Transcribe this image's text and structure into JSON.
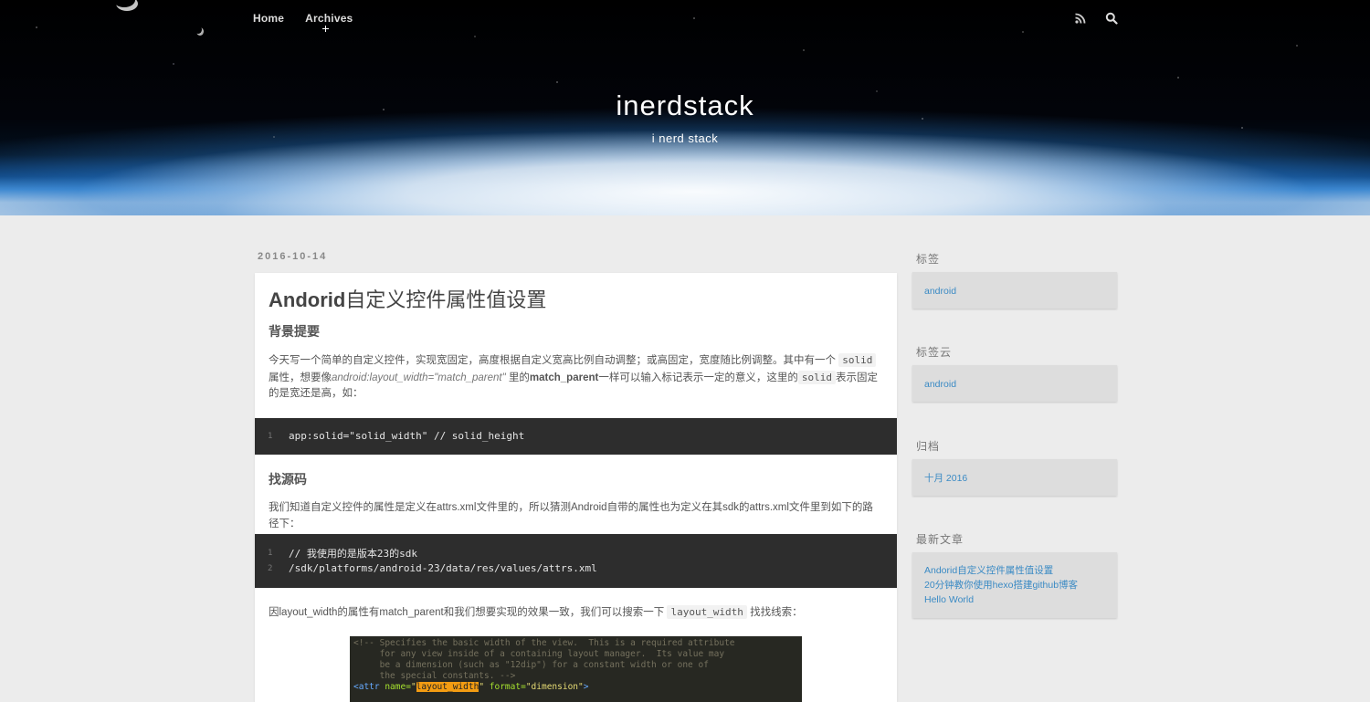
{
  "nav": {
    "items": [
      "Home",
      "Archives"
    ],
    "rss_icon": "rss-icon",
    "search_icon": "search-icon"
  },
  "site": {
    "title": "inerdstack",
    "subtitle": "i nerd stack"
  },
  "post": {
    "date": "2016-10-14",
    "title_prefix": "Andorid",
    "title_rest": "自定义控件属性值设置",
    "section1": "背景提要",
    "p1_a": "今天写一个简单的自定义控件，实现宽固定，高度根据自定义宽高比例自动调整；或高固定，宽度随比例调整。其中有一个",
    "p1_code1": "solid",
    "p1_b": "属性，想要像",
    "p1_italic": "android:layout_width=\"match_parent\"",
    "p1_c": "里的",
    "p1_bold": "match_parent",
    "p1_d": "一样可以输入标记表示一定的意义，这里的",
    "p1_code2": "solid",
    "p1_e": "表示固定的是宽还是高，如：",
    "code1": [
      {
        "n": "1",
        "text": "app:solid=\"solid_width\" // solid_height"
      }
    ],
    "section2": "找源码",
    "p2": "我们知道自定义控件的属性是定义在attrs.xml文件里的，所以猜测Android自带的属性也为定义在其sdk的attrs.xml文件里到如下的路径下：",
    "code2": [
      {
        "n": "1",
        "text": "// 我使用的是版本23的sdk"
      },
      {
        "n": "2",
        "text": "/sdk/platforms/android-23/data/res/values/attrs.xml"
      }
    ],
    "p3_a": "因layout_width的属性有match_parent和我们想要实现的效果一致，我们可以搜索一下",
    "p3_code": "layout_width",
    "p3_b": "找找线索：",
    "screenshot": {
      "l1": "<!-- Specifies the basic width of the view.  This is a required attribute",
      "l2": "     for any view inside of a containing layout manager.  Its value may",
      "l3": "     be a dimension (such as \"12dip\") for a constant width or one of",
      "l4": "     the special constants. -->",
      "l5_tag": "<attr",
      "l5_name_attr": " name=",
      "l5_q1": "\"",
      "l5_hl": "layout_width",
      "l5_q2": "\"",
      "l5_format_attr": " format=",
      "l5_format_val": "\"dimension\"",
      "l5_end": ">"
    }
  },
  "sidebar": {
    "tags_title": "标签",
    "tags": [
      "android"
    ],
    "tagcloud_title": "标签云",
    "tagcloud": [
      "android"
    ],
    "archive_title": "归档",
    "archives": [
      "十月 2016"
    ],
    "recent_title": "最新文章",
    "recent": [
      "Andorid自定义控件属性值设置",
      "20分钟教你使用hexo搭建github博客",
      "Hello World"
    ]
  }
}
